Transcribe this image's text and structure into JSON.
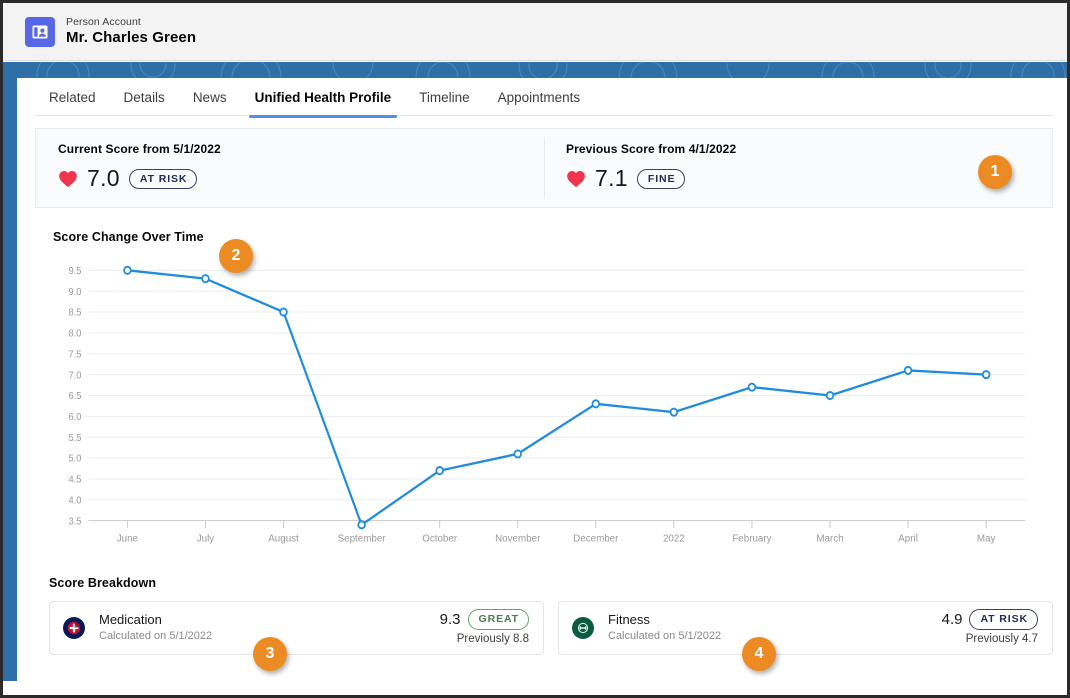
{
  "header": {
    "account_type": "Person Account",
    "account_name": "Mr. Charles Green",
    "avatar_icon": "person-account-icon"
  },
  "tabs": [
    {
      "label": "Related",
      "active": false
    },
    {
      "label": "Details",
      "active": false
    },
    {
      "label": "News",
      "active": false
    },
    {
      "label": "Unified Health Profile",
      "active": true
    },
    {
      "label": "Timeline",
      "active": false
    },
    {
      "label": "Appointments",
      "active": false
    }
  ],
  "score_summary": {
    "current": {
      "caption": "Current Score from 5/1/2022",
      "value": "7.0",
      "status": "AT RISK",
      "status_color": "#1c2a56",
      "icon": "heart-icon",
      "icon_color": "#f2344e"
    },
    "previous": {
      "caption": "Previous Score from 4/1/2022",
      "value": "7.1",
      "status": "FINE",
      "status_color": "#1c2a56",
      "icon": "heart-icon",
      "icon_color": "#f2344e"
    }
  },
  "chart_data": {
    "type": "line",
    "title": "Score Change Over Time",
    "xlabel": "",
    "ylabel": "",
    "categories": [
      "June",
      "July",
      "August",
      "September",
      "October",
      "November",
      "December",
      "2022",
      "February",
      "March",
      "April",
      "May"
    ],
    "values": [
      9.5,
      9.3,
      8.5,
      3.4,
      4.7,
      5.1,
      6.3,
      6.1,
      6.7,
      6.5,
      7.1,
      7.0
    ],
    "series": [
      {
        "name": "Score",
        "values": [
          9.5,
          9.3,
          8.5,
          3.4,
          4.7,
          5.1,
          6.3,
          6.1,
          6.7,
          6.5,
          7.1,
          7.0
        ]
      }
    ],
    "ylim": [
      3.5,
      9.5
    ],
    "yticks": [
      "9.5",
      "9.0",
      "8.5",
      "8.0",
      "7.5",
      "7.0",
      "6.5",
      "6.0",
      "5.5",
      "5.0",
      "4.5",
      "4.0",
      "3.5"
    ],
    "ytick_values": [
      9.5,
      9.0,
      8.5,
      8.0,
      7.5,
      7.0,
      6.5,
      6.0,
      5.5,
      5.0,
      4.5,
      4.0,
      3.5
    ],
    "grid": true,
    "legend": "none",
    "line_color": "#1f8ce0",
    "marker": "open-circle"
  },
  "breakdown": {
    "title": "Score Breakdown",
    "items": [
      {
        "name": "Medication",
        "subtitle": "Calculated on 5/1/2022",
        "score": "9.3",
        "status": "GREAT",
        "previous": "Previously 8.8",
        "icon": "medication-icon",
        "icon_color": "#0b1a56"
      },
      {
        "name": "Fitness",
        "subtitle": "Calculated on 5/1/2022",
        "score": "4.9",
        "status": "AT RISK",
        "previous": "Previously 4.7",
        "icon": "fitness-icon",
        "icon_color": "#0b5b41"
      }
    ]
  },
  "callouts": [
    {
      "number": "1"
    },
    {
      "number": "2"
    },
    {
      "number": "3"
    },
    {
      "number": "4"
    }
  ]
}
